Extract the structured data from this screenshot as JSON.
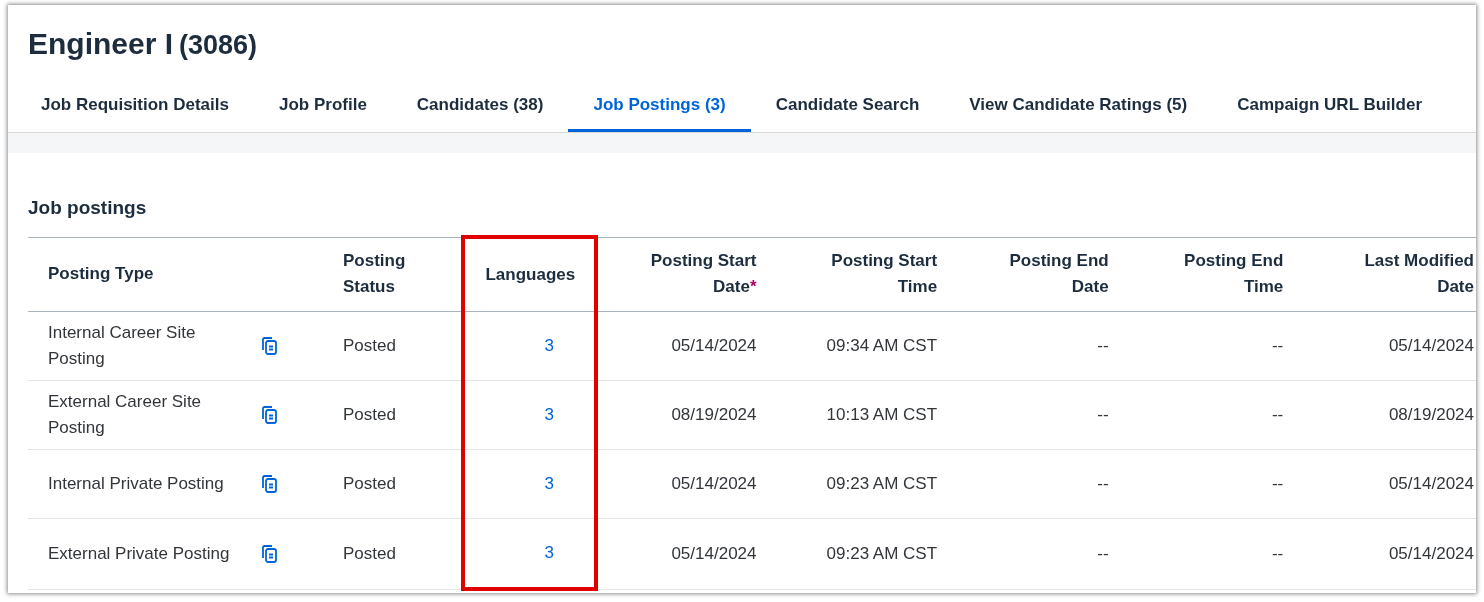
{
  "header": {
    "title": "Engineer I",
    "id": "(3086)"
  },
  "tabs": [
    {
      "label": "Job Requisition Details",
      "selected": false
    },
    {
      "label": "Job Profile",
      "selected": false
    },
    {
      "label": "Candidates (38)",
      "selected": false
    },
    {
      "label": "Job Postings (3)",
      "selected": true
    },
    {
      "label": "Candidate Search",
      "selected": false
    },
    {
      "label": "View Candidate Ratings (5)",
      "selected": false
    },
    {
      "label": "Campaign URL Builder",
      "selected": false
    }
  ],
  "section": {
    "title": "Job postings"
  },
  "table": {
    "columns": [
      {
        "label": "Posting Type",
        "highlighted": false
      },
      {
        "label": "Posting Status",
        "highlighted": false
      },
      {
        "label": "Languages",
        "highlighted": true
      },
      {
        "label": "Posting Start Date",
        "required_mark": "*",
        "highlighted": false
      },
      {
        "label": "Posting Start Time",
        "highlighted": false
      },
      {
        "label": "Posting End Date",
        "highlighted": false
      },
      {
        "label": "Posting End Time",
        "highlighted": false
      },
      {
        "label": "Last Modified Date",
        "highlighted": false
      }
    ],
    "rows": [
      {
        "cells": [
          "Internal Career Site Posting",
          "Posted",
          "3",
          "05/14/2024",
          "09:34 AM CST",
          "--",
          "--",
          "05/14/2024"
        ]
      },
      {
        "cells": [
          "External Career Site Posting",
          "Posted",
          "3",
          "08/19/2024",
          "10:13 AM CST",
          "--",
          "--",
          "08/19/2024"
        ]
      },
      {
        "cells": [
          "Internal Private Posting",
          "Posted",
          "3",
          "05/14/2024",
          "09:23 AM CST",
          "--",
          "--",
          "05/14/2024"
        ]
      },
      {
        "cells": [
          "External Private Posting",
          "Posted",
          "3",
          "05/14/2024",
          "09:23 AM CST",
          "--",
          "--",
          "05/14/2024"
        ]
      }
    ]
  }
}
